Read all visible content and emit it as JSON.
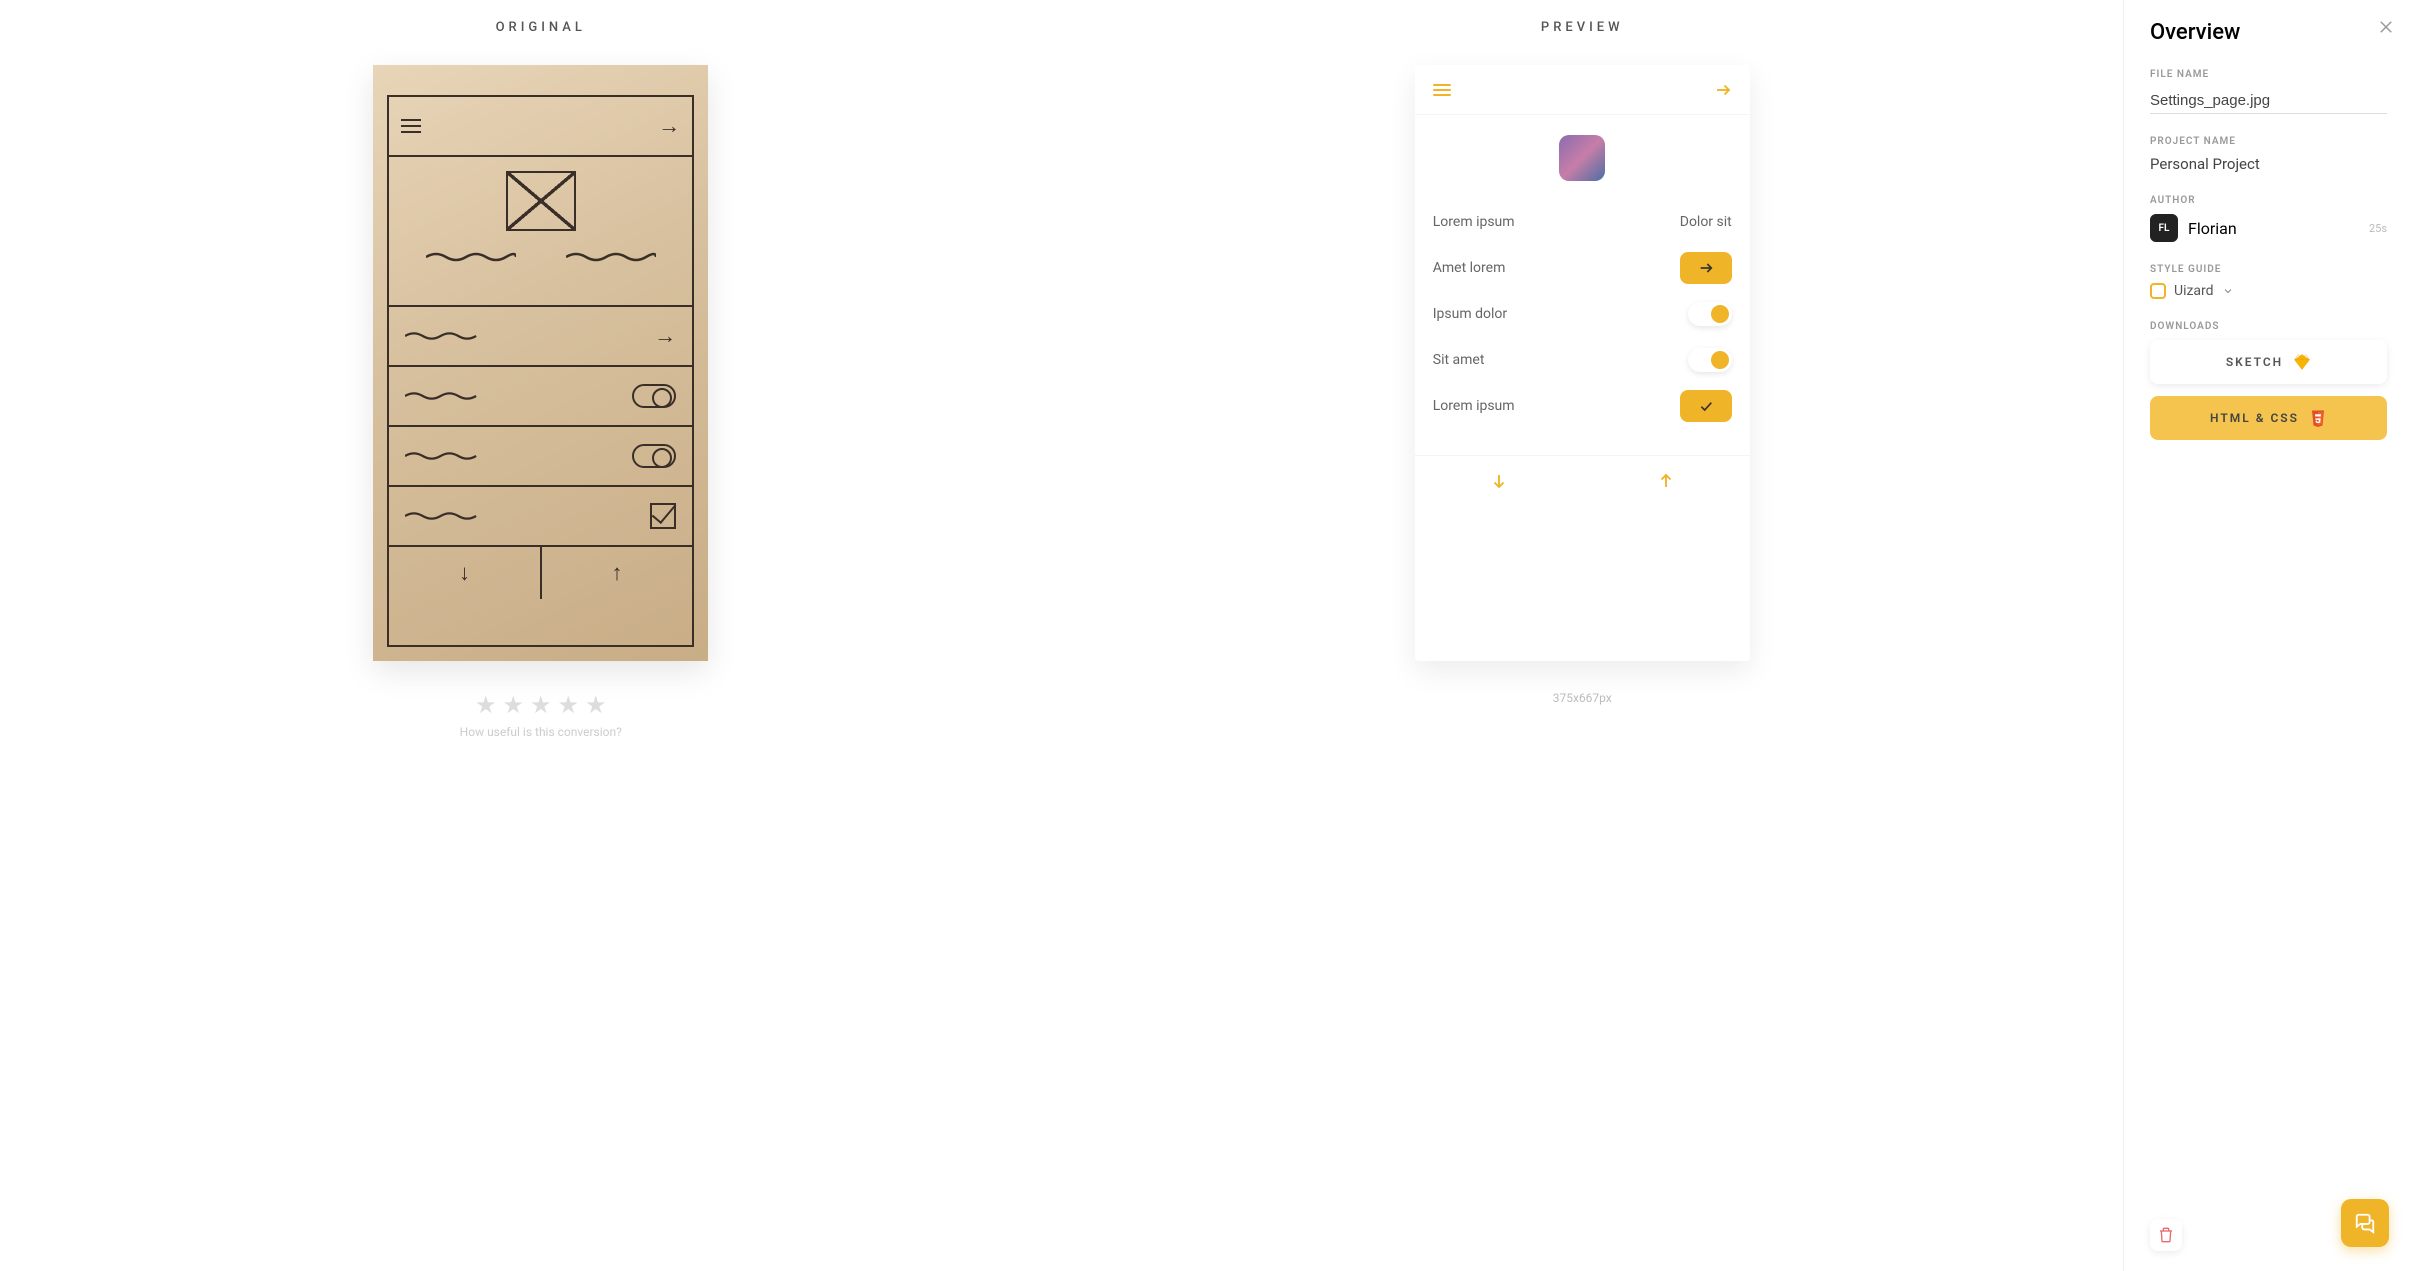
{
  "panels": {
    "original_title": "ORIGINAL",
    "preview_title": "PREVIEW"
  },
  "rating": {
    "caption": "How useful is this conversion?"
  },
  "preview": {
    "row1_left": "Lorem ipsum",
    "row1_right": "Dolor sit",
    "row2": "Amet lorem",
    "row3": "Ipsum dolor",
    "row4": "Sit amet",
    "row5": "Lorem ipsum",
    "dimensions": "375x667px"
  },
  "sidebar": {
    "title": "Overview",
    "file_name_label": "FILE NAME",
    "file_name_value": "Settings_page.jpg",
    "project_name_label": "PROJECT NAME",
    "project_name_value": "Personal Project",
    "author_label": "AUTHOR",
    "author_badge": "FL",
    "author_name": "Florian",
    "author_time": "25s",
    "style_guide_label": "STYLE GUIDE",
    "style_guide_value": "Uizard",
    "downloads_label": "DOWNLOADS",
    "sketch_btn": "SKETCH",
    "html_btn": "HTML & CSS"
  }
}
